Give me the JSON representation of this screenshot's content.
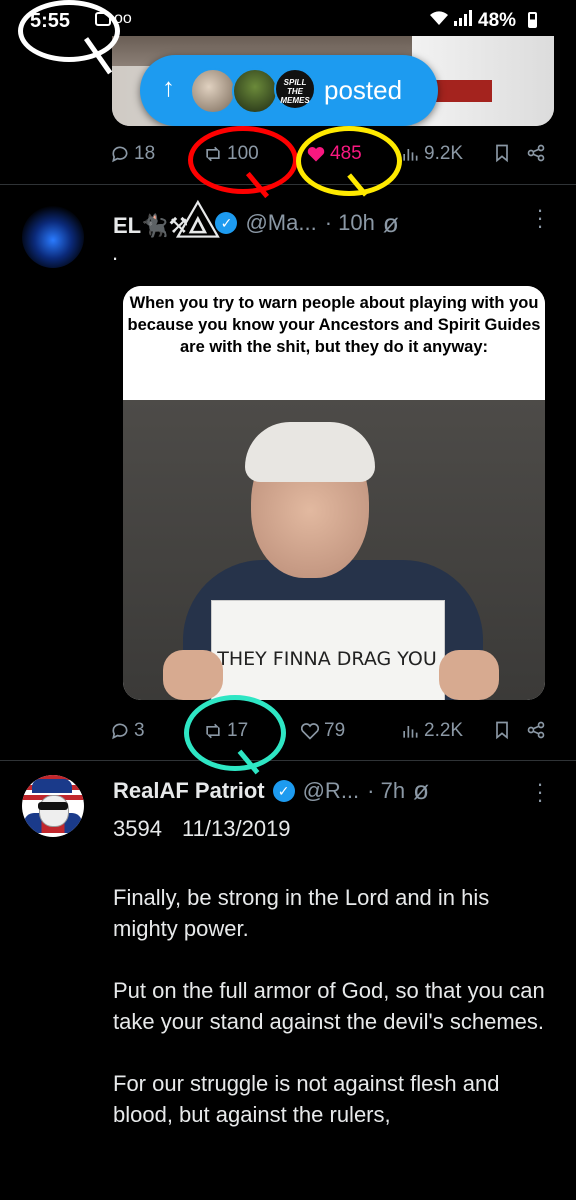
{
  "status_bar": {
    "time": "5:55",
    "battery": "48%"
  },
  "posted_pill": {
    "arrow": "↑",
    "label": "posted",
    "avatar3_text": "SPILL THE MEMES"
  },
  "tweet1_actions": {
    "replies": "18",
    "reposts": "100",
    "likes": "485",
    "views": "9.2K"
  },
  "tweet2": {
    "name": "EL🐈‍⬛⚒🜂⃤",
    "handle": "@Ma...",
    "time": "· 10h",
    "text": ".",
    "meme_caption": "When you try to warn people about playing with you because you know your Ancestors and Spirit Guides are with the shit, but they do it anyway:",
    "sign_text": "THEY FINNA DRAG YOU",
    "actions": {
      "replies": "3",
      "reposts": "17",
      "likes": "79",
      "views": "2.2K"
    }
  },
  "tweet3": {
    "name": "RealAF Patriot",
    "handle": "@R...",
    "time": "· 7h",
    "subline": "3594 11/13/2019",
    "paragraphs": [
      "Finally, be strong in the Lord and in his mighty power.",
      "Put on the full armor of God, so that you can take your stand against the devil's schemes.",
      "For our struggle is not against flesh and blood, but against the rulers,"
    ]
  },
  "icons": [
    "reply-icon",
    "repost-icon",
    "like-icon",
    "views-icon",
    "bookmark-icon",
    "share-icon",
    "grok-icon",
    "more-icon",
    "verified-icon"
  ],
  "colors": {
    "accent": "#1d9bf0",
    "like": "#f91880",
    "red_annotation": "#ff0000",
    "yellow_annotation": "#ffea00",
    "teal_annotation": "#2ee6c4"
  }
}
